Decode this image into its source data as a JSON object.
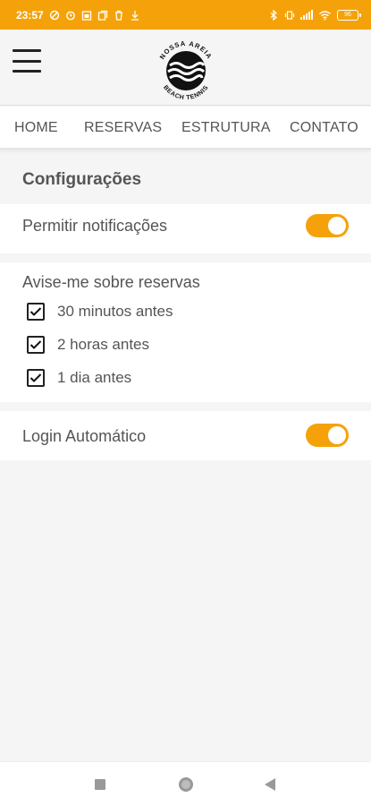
{
  "status_bar": {
    "time": "23:57",
    "battery_level": "96",
    "background_color": "#f5a20a"
  },
  "header": {
    "menu_icon": "hamburger-menu-icon",
    "logo": {
      "top_text": "NOSSA AREIA",
      "bottom_text": "BEACH TENNIS"
    }
  },
  "nav": {
    "tabs": [
      {
        "label": "HOME"
      },
      {
        "label": "RESERVAS"
      },
      {
        "label": "ESTRUTURA"
      },
      {
        "label": "CONTATO"
      }
    ]
  },
  "settings": {
    "title": "Configurações",
    "notifications": {
      "label": "Permitir notificações",
      "enabled": true
    },
    "reminders": {
      "label": "Avise-me sobre reservas",
      "options": [
        {
          "label": "30 minutos antes",
          "checked": true
        },
        {
          "label": "2 horas antes",
          "checked": true
        },
        {
          "label": "1 dia antes",
          "checked": true
        }
      ]
    },
    "auto_login": {
      "label": "Login Automático",
      "enabled": true
    }
  },
  "colors": {
    "accent": "#f5a20a",
    "text": "#555555",
    "background": "#f5f5f5"
  },
  "system_nav": {
    "icons": [
      "recent-apps-icon",
      "home-icon",
      "back-icon"
    ]
  }
}
